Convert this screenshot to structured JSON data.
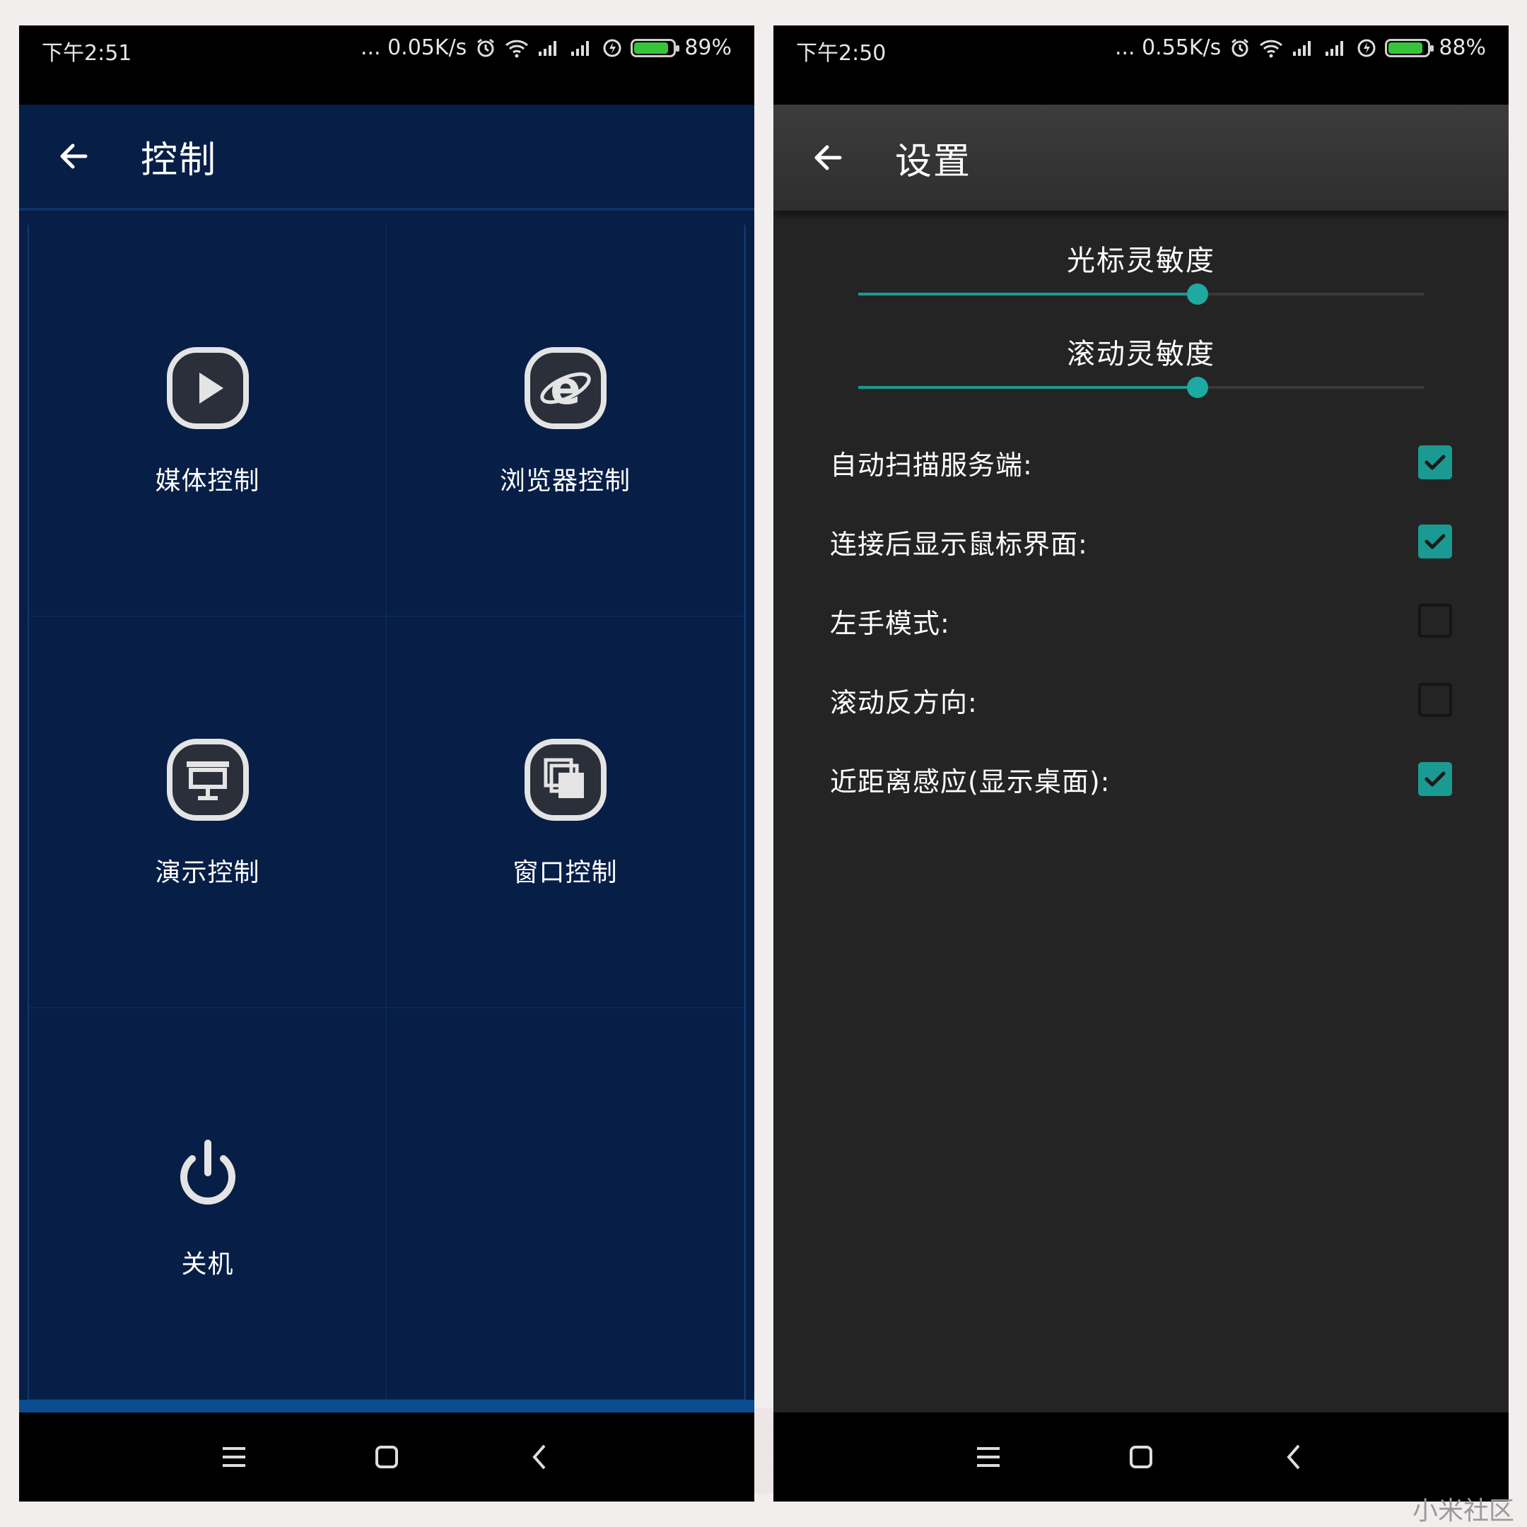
{
  "left_phone": {
    "status_bar": {
      "time": "下午2:51",
      "net_speed": "... 0.05K/s",
      "battery_text": "89%",
      "battery_level": 0.89
    },
    "app_bar": {
      "title": "控制",
      "back_icon": "arrow-left-icon"
    },
    "tiles": [
      {
        "label": "媒体控制",
        "icon": "play-icon"
      },
      {
        "label": "浏览器控制",
        "icon": "browser-e-icon"
      },
      {
        "label": "演示控制",
        "icon": "presentation-icon"
      },
      {
        "label": "窗口控制",
        "icon": "windows-icon"
      },
      {
        "label": "关机",
        "icon": "power-icon"
      }
    ],
    "nav_bar": [
      "menu-icon",
      "home-icon",
      "back-chevron-icon"
    ]
  },
  "right_phone": {
    "status_bar": {
      "time": "下午2:50",
      "net_speed": "... 0.55K/s",
      "battery_text": "88%",
      "battery_level": 0.88
    },
    "app_bar": {
      "title": "设置",
      "back_icon": "arrow-left-icon"
    },
    "sliders": [
      {
        "label": "光标灵敏度",
        "value": 0.6
      },
      {
        "label": "滚动灵敏度",
        "value": 0.6
      }
    ],
    "settings": [
      {
        "label": "自动扫描服务端:",
        "checked": true
      },
      {
        "label": "连接后显示鼠标界面:",
        "checked": true
      },
      {
        "label": "左手模式:",
        "checked": false
      },
      {
        "label": "滚动反方向:",
        "checked": false
      },
      {
        "label": "近距离感应(显示桌面):",
        "checked": true
      }
    ],
    "nav_bar": [
      "menu-icon",
      "home-icon",
      "back-chevron-icon"
    ]
  },
  "colors": {
    "left_bg": "#071e47",
    "right_bg": "#242424",
    "accent_teal": "#1a9a92",
    "battery_green": "#37c43a"
  },
  "watermark": "小米社区"
}
